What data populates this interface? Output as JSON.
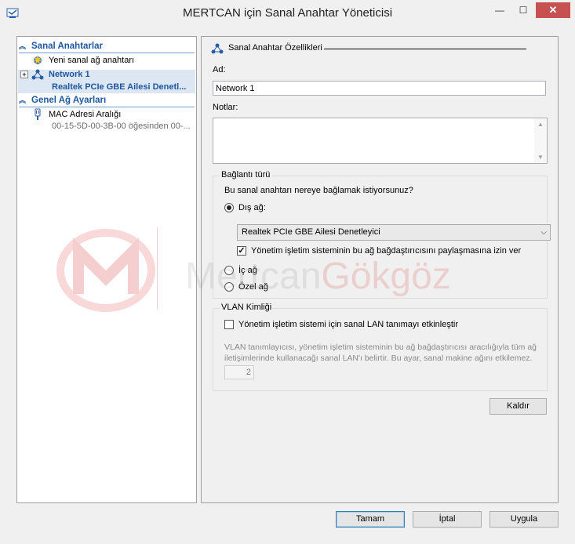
{
  "window": {
    "title": "MERTCAN için Sanal Anahtar Yöneticisi",
    "controls": {
      "minimize": "—",
      "maximize": "☐",
      "close": "✕"
    }
  },
  "left": {
    "section1": "Sanal Anahtarlar",
    "new_switch": "Yeni sanal ağ anahtarı",
    "network_name": "Network 1",
    "network_adapter": "Realtek PCIe GBE Ailesi Denetl...",
    "section2": "Genel Ağ Ayarları",
    "mac_title": "MAC Adresi Aralığı",
    "mac_value": "00-15-5D-00-3B-00 öğesinden 00-..."
  },
  "props": {
    "title": "Sanal Anahtar Özellikleri",
    "name_label": "Ad:",
    "name_value": "Network 1",
    "notes_label": "Notlar:",
    "connection_group": "Bağlantı türü",
    "connection_question": "Bu sanal anahtarı nereye bağlamak istiyorsunuz?",
    "external_label": "Dış ağ:",
    "external_selected": "Realtek PCIe GBE Ailesi Denetleyici",
    "allow_share_label": "Yönetim işletim sisteminin bu ağ bağdaştırıcısını paylaşmasına izin ver",
    "internal_label": "İç ağ",
    "private_label": "Özel ağ",
    "vlan_group": "VLAN Kimliği",
    "vlan_check_label": "Yönetim işletim sistemi için sanal LAN tanımayı etkinleştir",
    "vlan_desc": "VLAN tanımlayıcısı, yönetim işletim sisteminin bu ağ bağdaştırıcısı aracılığıyla tüm ağ iletişimlerinde kullanacağı sanal LAN'ı belirtir. Bu ayar, sanal makine ağını etkilemez.",
    "vlan_value": "2",
    "remove_button": "Kaldır"
  },
  "footer": {
    "ok": "Tamam",
    "cancel": "İptal",
    "apply": "Uygula"
  },
  "watermark": {
    "text_gray": "Mertcan",
    "text_red": "Gökgöz"
  },
  "icons": {
    "app": "network-manager-icon",
    "new_switch": "new-switch-icon",
    "network": "network-switch-icon",
    "mac": "mac-range-icon"
  }
}
